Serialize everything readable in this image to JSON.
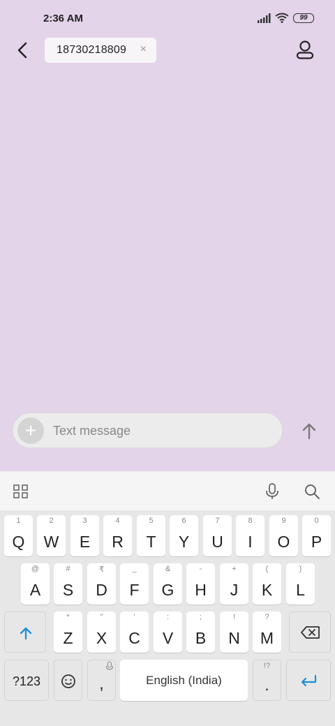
{
  "status_bar": {
    "time": "2:36 AM",
    "battery": "99"
  },
  "header": {
    "recipient": "18730218809",
    "remove_chip_symbol": "×"
  },
  "composer": {
    "placeholder": "Text message",
    "add_symbol": "+"
  },
  "keyboard": {
    "row1": [
      {
        "key": "Q",
        "hint": "1"
      },
      {
        "key": "W",
        "hint": "2"
      },
      {
        "key": "E",
        "hint": "3"
      },
      {
        "key": "R",
        "hint": "4"
      },
      {
        "key": "T",
        "hint": "5"
      },
      {
        "key": "Y",
        "hint": "6"
      },
      {
        "key": "U",
        "hint": "7"
      },
      {
        "key": "I",
        "hint": "8"
      },
      {
        "key": "O",
        "hint": "9"
      },
      {
        "key": "P",
        "hint": "0"
      }
    ],
    "row2": [
      {
        "key": "A",
        "hint": "@"
      },
      {
        "key": "S",
        "hint": "#"
      },
      {
        "key": "D",
        "hint": "₹"
      },
      {
        "key": "F",
        "hint": "_"
      },
      {
        "key": "G",
        "hint": "&"
      },
      {
        "key": "H",
        "hint": "-"
      },
      {
        "key": "J",
        "hint": "+"
      },
      {
        "key": "K",
        "hint": "("
      },
      {
        "key": "L",
        "hint": ")"
      }
    ],
    "row3": [
      {
        "key": "Z",
        "hint": "*"
      },
      {
        "key": "X",
        "hint": "\""
      },
      {
        "key": "C",
        "hint": "'"
      },
      {
        "key": "V",
        "hint": ":"
      },
      {
        "key": "B",
        "hint": ";"
      },
      {
        "key": "N",
        "hint": "!"
      },
      {
        "key": "M",
        "hint": "?"
      }
    ],
    "symbols_label": "?123",
    "comma_label": ",",
    "space_label": "English (India)",
    "period_label": ".",
    "period_hint": "!?"
  },
  "colors": {
    "background": "#e3d4ea",
    "accent": "#1a8fd6"
  },
  "icons": [
    "back-arrow-icon",
    "contact-icon",
    "send-icon",
    "apps-grid-icon",
    "microphone-icon",
    "search-icon",
    "shift-icon",
    "backspace-icon",
    "emoji-icon",
    "enter-icon"
  ]
}
